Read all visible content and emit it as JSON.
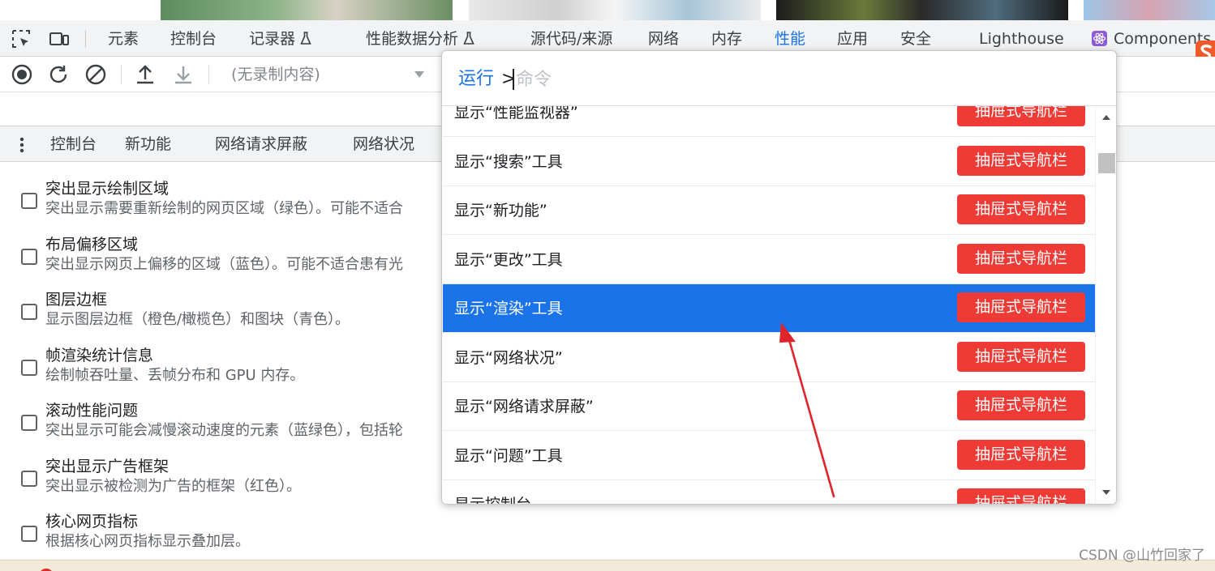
{
  "main_tabs": [
    {
      "label": "元素",
      "active": false
    },
    {
      "label": "控制台",
      "active": false
    },
    {
      "label": "记录器",
      "active": false
    },
    {
      "label": "性能数据分析",
      "active": false
    },
    {
      "label": "源代码/来源",
      "active": false
    },
    {
      "label": "网络",
      "active": false
    },
    {
      "label": "内存",
      "active": false
    },
    {
      "label": "性能",
      "active": true
    },
    {
      "label": "应用",
      "active": false
    },
    {
      "label": "安全",
      "active": false
    },
    {
      "label": "Lighthouse",
      "active": false
    },
    {
      "label": "Components",
      "active": false
    }
  ],
  "toolbar": {
    "recording_placeholder": "(无录制内容)"
  },
  "drawer_tabs": [
    {
      "label": "控制台"
    },
    {
      "label": "新功能"
    },
    {
      "label": "网络请求屏蔽"
    },
    {
      "label": "网络状况"
    }
  ],
  "rendering_options": [
    {
      "title": "突出显示绘制区域",
      "desc": "突出显示需要重新绘制的网页区域（绿色）。可能不适合",
      "checked": false
    },
    {
      "title": "布局偏移区域",
      "desc": "突出显示网页上偏移的区域（蓝色）。可能不适合患有光",
      "checked": false
    },
    {
      "title": "图层边框",
      "desc": "显示图层边框（橙色/橄榄色）和图块（青色）。",
      "checked": false
    },
    {
      "title": "帧渲染统计信息",
      "desc": "绘制帧吞吐量、丢帧分布和 GPU 内存。",
      "checked": false
    },
    {
      "title": "滚动性能问题",
      "desc": "突出显示可能会减慢滚动速度的元素（蓝绿色），包括轮",
      "checked": false
    },
    {
      "title": "突出显示广告框架",
      "desc": "突出显示被检测为广告的框架（红色）。",
      "checked": false
    },
    {
      "title": "核心网页指标",
      "desc": "根据核心网页指标显示叠加层。",
      "checked": false
    }
  ],
  "command_menu": {
    "prefix": "运行",
    "gt": ">",
    "placeholder": "命令",
    "items": [
      {
        "label": "显示“性能监视器”",
        "badge": "抽屉式导航栏",
        "selected": false
      },
      {
        "label": "显示“搜索”工具",
        "badge": "抽屉式导航栏",
        "selected": false
      },
      {
        "label": "显示“新功能”",
        "badge": "抽屉式导航栏",
        "selected": false
      },
      {
        "label": "显示“更改”工具",
        "badge": "抽屉式导航栏",
        "selected": false
      },
      {
        "label": "显示“渲染”工具",
        "badge": "抽屉式导航栏",
        "selected": true
      },
      {
        "label": "显示“网络状况”",
        "badge": "抽屉式导航栏",
        "selected": false
      },
      {
        "label": "显示“网络请求屏蔽”",
        "badge": "抽屉式导航栏",
        "selected": false
      },
      {
        "label": "显示“问题”工具",
        "badge": "抽屉式导航栏",
        "selected": false
      },
      {
        "label": "显示控制台",
        "badge": "抽屉式导航栏",
        "selected": false
      }
    ]
  },
  "watermark": "CSDN @山竹回家了",
  "colors": {
    "accent": "#1a73e8",
    "badge": "#ee3b35",
    "annotation": "#e0242b"
  }
}
